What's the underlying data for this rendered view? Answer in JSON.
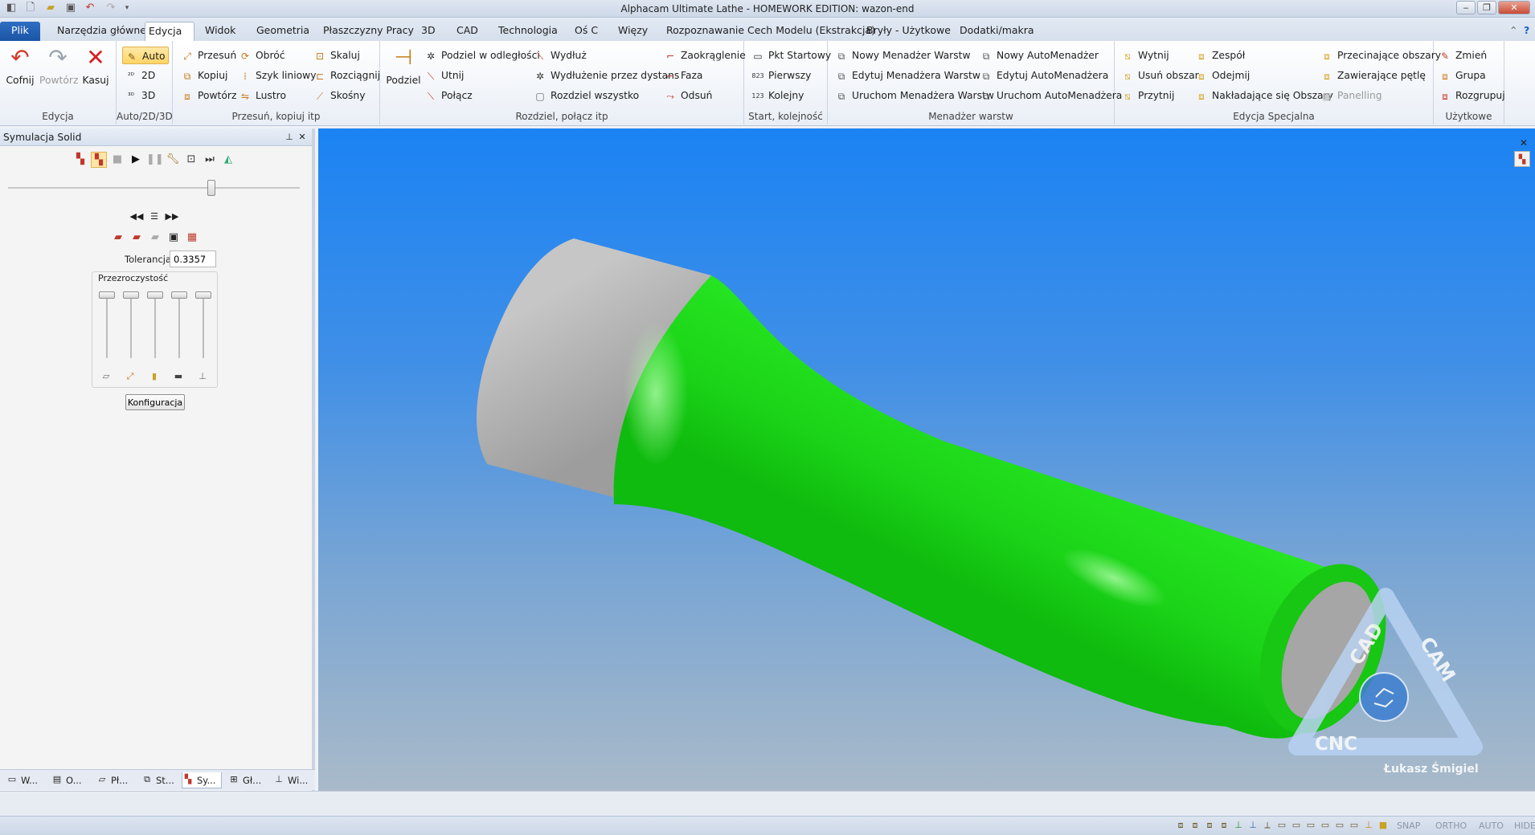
{
  "window": {
    "title": "Alphacam Ultimate Lathe - HOMEWORK EDITION: wazon-end",
    "minimize": "‒",
    "restore": "❐",
    "close": "✕"
  },
  "tabs": {
    "file": "Plik",
    "items": [
      "Narzędzia główne",
      "Edycja",
      "Widok",
      "Geometria",
      "Płaszczyzny Pracy",
      "3D",
      "CAD",
      "Technologia",
      "Oś C",
      "Więzy",
      "Rozpoznawanie Cech Modelu (Ekstrakcja)",
      "Bryły - Użytkowe",
      "Dodatki/makra"
    ],
    "active": "Edycja"
  },
  "ribbon": {
    "edycja": {
      "label": "Edycja",
      "undo": "Cofnij",
      "redo": "Powtórz",
      "delete": "Kasuj"
    },
    "auto": {
      "label": "Auto/2D/3D",
      "auto": "Auto",
      "d2": "2D",
      "d3": "3D"
    },
    "move": {
      "label": "Przesuń, kopiuj itp",
      "move": "Przesuń",
      "copy": "Kopiuj",
      "repeat": "Powtórz",
      "rotate": "Obróć",
      "linear_array": "Szyk liniowy",
      "mirror": "Lustro",
      "scale": "Skaluj",
      "stretch": "Rozciągnij",
      "skew": "Skośny"
    },
    "split": {
      "label": "Rozdziel, połącz itp",
      "split": "Podziel",
      "split_dist": "Podziel w odległości",
      "trim": "Utnij",
      "join": "Połącz",
      "extend": "Wydłuż",
      "extend_dist": "Wydłużenie przez dystans",
      "split_all": "Rozdziel wszystko",
      "fillet": "Zaokrąglenie",
      "chamfer": "Faza",
      "offset": "Odsuń"
    },
    "start": {
      "label": "Start, kolejność",
      "start_pt": "Pkt Startowy",
      "first": "Pierwszy",
      "order": "Kolejny"
    },
    "layers": {
      "label": "Menadżer warstw",
      "new_mgr": "Nowy Menadżer Warstw",
      "edit_mgr": "Edytuj Menadżera Warstw",
      "run_mgr": "Uruchom Menadżera Warstw",
      "new_auto": "Nowy AutoMenadżer",
      "edit_auto": "Edytuj AutoMenadżera",
      "run_auto": "Uruchom AutoMenadżera"
    },
    "special": {
      "label": "Edycja Specjalna",
      "cut": "Wytnij",
      "remove_area": "Usuń obszar",
      "trim2": "Przytnij",
      "assembly": "Zespół",
      "subtract": "Odejmij",
      "overlap": "Nakładające się Obszary",
      "intersect": "Przecinające obszary",
      "containing": "Zawierające pętlę",
      "panelling": "Panelling"
    },
    "user": {
      "label": "Użytkowe",
      "change": "Zmień",
      "group": "Grupa",
      "ungroup": "Rozgrupuj"
    }
  },
  "panel": {
    "title": "Symulacja Solid",
    "pin": "⊥",
    "close": "✕",
    "tolerance_label": "Tolerancja",
    "tolerance_value": "0.3357",
    "transparency_label": "Przezroczystość",
    "config_button": "Konfiguracja"
  },
  "bottom_tabs": [
    "W...",
    "O...",
    "Pł...",
    "St...",
    "Sy...",
    "Gł...",
    "Wi..."
  ],
  "watermark": {
    "top": "CAD",
    "right": "CAM",
    "bottom": "CNC",
    "author": "Łukasz Śmigiel"
  },
  "status": {
    "snap": "SNAP",
    "ortho": "ORTHO",
    "auto": "AUTO",
    "hide": "HIDE"
  },
  "colors": {
    "accent": "#1b54a5",
    "viewport_top": "#1b83f3",
    "viewport_bottom": "#a9bac9",
    "part_green": "#22e51e",
    "part_gray": "#b8b8b8"
  }
}
